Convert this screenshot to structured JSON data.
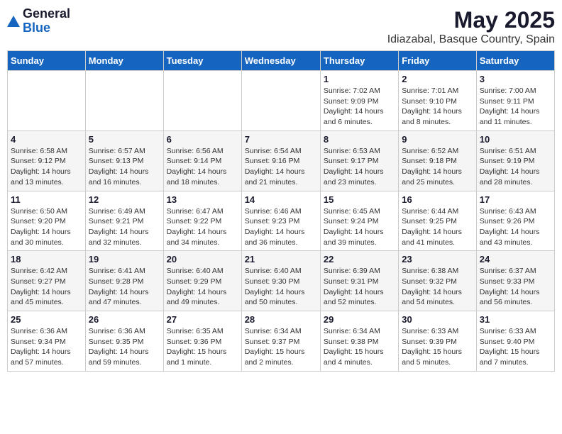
{
  "logo": {
    "general": "General",
    "blue": "Blue"
  },
  "title": "May 2025",
  "subtitle": "Idiazabal, Basque Country, Spain",
  "days_of_week": [
    "Sunday",
    "Monday",
    "Tuesday",
    "Wednesday",
    "Thursday",
    "Friday",
    "Saturday"
  ],
  "weeks": [
    [
      {
        "day": "",
        "info": ""
      },
      {
        "day": "",
        "info": ""
      },
      {
        "day": "",
        "info": ""
      },
      {
        "day": "",
        "info": ""
      },
      {
        "day": "1",
        "info": "Sunrise: 7:02 AM\nSunset: 9:09 PM\nDaylight: 14 hours\nand 6 minutes."
      },
      {
        "day": "2",
        "info": "Sunrise: 7:01 AM\nSunset: 9:10 PM\nDaylight: 14 hours\nand 8 minutes."
      },
      {
        "day": "3",
        "info": "Sunrise: 7:00 AM\nSunset: 9:11 PM\nDaylight: 14 hours\nand 11 minutes."
      }
    ],
    [
      {
        "day": "4",
        "info": "Sunrise: 6:58 AM\nSunset: 9:12 PM\nDaylight: 14 hours\nand 13 minutes."
      },
      {
        "day": "5",
        "info": "Sunrise: 6:57 AM\nSunset: 9:13 PM\nDaylight: 14 hours\nand 16 minutes."
      },
      {
        "day": "6",
        "info": "Sunrise: 6:56 AM\nSunset: 9:14 PM\nDaylight: 14 hours\nand 18 minutes."
      },
      {
        "day": "7",
        "info": "Sunrise: 6:54 AM\nSunset: 9:16 PM\nDaylight: 14 hours\nand 21 minutes."
      },
      {
        "day": "8",
        "info": "Sunrise: 6:53 AM\nSunset: 9:17 PM\nDaylight: 14 hours\nand 23 minutes."
      },
      {
        "day": "9",
        "info": "Sunrise: 6:52 AM\nSunset: 9:18 PM\nDaylight: 14 hours\nand 25 minutes."
      },
      {
        "day": "10",
        "info": "Sunrise: 6:51 AM\nSunset: 9:19 PM\nDaylight: 14 hours\nand 28 minutes."
      }
    ],
    [
      {
        "day": "11",
        "info": "Sunrise: 6:50 AM\nSunset: 9:20 PM\nDaylight: 14 hours\nand 30 minutes."
      },
      {
        "day": "12",
        "info": "Sunrise: 6:49 AM\nSunset: 9:21 PM\nDaylight: 14 hours\nand 32 minutes."
      },
      {
        "day": "13",
        "info": "Sunrise: 6:47 AM\nSunset: 9:22 PM\nDaylight: 14 hours\nand 34 minutes."
      },
      {
        "day": "14",
        "info": "Sunrise: 6:46 AM\nSunset: 9:23 PM\nDaylight: 14 hours\nand 36 minutes."
      },
      {
        "day": "15",
        "info": "Sunrise: 6:45 AM\nSunset: 9:24 PM\nDaylight: 14 hours\nand 39 minutes."
      },
      {
        "day": "16",
        "info": "Sunrise: 6:44 AM\nSunset: 9:25 PM\nDaylight: 14 hours\nand 41 minutes."
      },
      {
        "day": "17",
        "info": "Sunrise: 6:43 AM\nSunset: 9:26 PM\nDaylight: 14 hours\nand 43 minutes."
      }
    ],
    [
      {
        "day": "18",
        "info": "Sunrise: 6:42 AM\nSunset: 9:27 PM\nDaylight: 14 hours\nand 45 minutes."
      },
      {
        "day": "19",
        "info": "Sunrise: 6:41 AM\nSunset: 9:28 PM\nDaylight: 14 hours\nand 47 minutes."
      },
      {
        "day": "20",
        "info": "Sunrise: 6:40 AM\nSunset: 9:29 PM\nDaylight: 14 hours\nand 49 minutes."
      },
      {
        "day": "21",
        "info": "Sunrise: 6:40 AM\nSunset: 9:30 PM\nDaylight: 14 hours\nand 50 minutes."
      },
      {
        "day": "22",
        "info": "Sunrise: 6:39 AM\nSunset: 9:31 PM\nDaylight: 14 hours\nand 52 minutes."
      },
      {
        "day": "23",
        "info": "Sunrise: 6:38 AM\nSunset: 9:32 PM\nDaylight: 14 hours\nand 54 minutes."
      },
      {
        "day": "24",
        "info": "Sunrise: 6:37 AM\nSunset: 9:33 PM\nDaylight: 14 hours\nand 56 minutes."
      }
    ],
    [
      {
        "day": "25",
        "info": "Sunrise: 6:36 AM\nSunset: 9:34 PM\nDaylight: 14 hours\nand 57 minutes."
      },
      {
        "day": "26",
        "info": "Sunrise: 6:36 AM\nSunset: 9:35 PM\nDaylight: 14 hours\nand 59 minutes."
      },
      {
        "day": "27",
        "info": "Sunrise: 6:35 AM\nSunset: 9:36 PM\nDaylight: 15 hours\nand 1 minute."
      },
      {
        "day": "28",
        "info": "Sunrise: 6:34 AM\nSunset: 9:37 PM\nDaylight: 15 hours\nand 2 minutes."
      },
      {
        "day": "29",
        "info": "Sunrise: 6:34 AM\nSunset: 9:38 PM\nDaylight: 15 hours\nand 4 minutes."
      },
      {
        "day": "30",
        "info": "Sunrise: 6:33 AM\nSunset: 9:39 PM\nDaylight: 15 hours\nand 5 minutes."
      },
      {
        "day": "31",
        "info": "Sunrise: 6:33 AM\nSunset: 9:40 PM\nDaylight: 15 hours\nand 7 minutes."
      }
    ]
  ]
}
